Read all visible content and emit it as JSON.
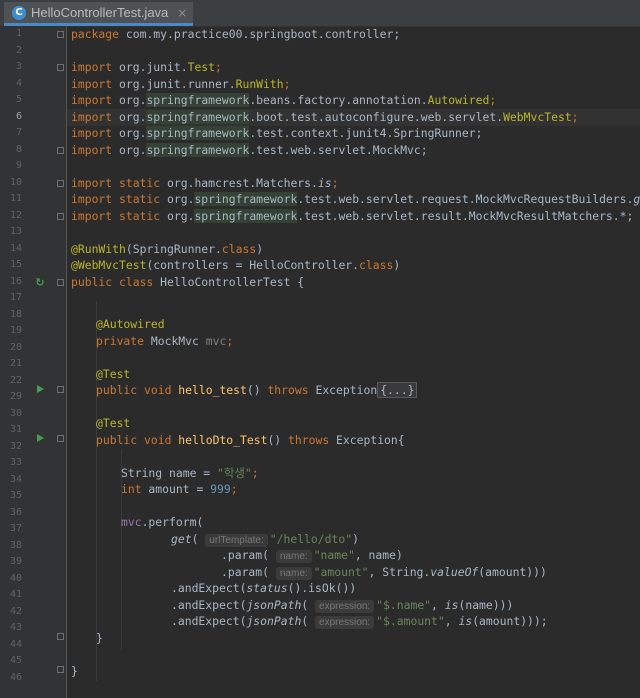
{
  "tab": {
    "icon": "java-class-icon",
    "filename": "HelloControllerTest.java",
    "close": "×"
  },
  "gutter": {
    "line_numbers": [
      "1",
      "2",
      "3",
      "4",
      "5",
      "6",
      "7",
      "8",
      "9",
      "10",
      "11",
      "12",
      "13",
      "14",
      "15",
      "16",
      "17",
      "18",
      "19",
      "20",
      "21",
      "22",
      "29",
      "30",
      "31",
      "32",
      "33",
      "34",
      "35",
      "36",
      "37",
      "38",
      "39",
      "40",
      "41",
      "42",
      "43",
      "44",
      "45",
      "46"
    ],
    "current_line": "6"
  },
  "code": {
    "l1": [
      "package",
      " com.my.practice00.springboot.controller;"
    ],
    "l3": [
      "import",
      " org.junit.",
      "Test",
      ";"
    ],
    "l4": [
      "import",
      " org.junit.runner.",
      "RunWith",
      ";"
    ],
    "l5": [
      "import",
      " org.",
      "springframework",
      ".beans.factory.annotation.",
      "Autowired",
      ";"
    ],
    "l6": [
      "import",
      " org.",
      "springframework",
      ".boot.test.autoconfigure.web.servlet.",
      "WebMvcTest",
      ";"
    ],
    "l7": [
      "import",
      " org.",
      "springframework",
      ".test.context.junit4.SpringRunner;"
    ],
    "l8": [
      "import",
      " org.",
      "springframework",
      ".test.web.servlet.MockMvc;"
    ],
    "l10": [
      "import static",
      " org.hamcrest.Matchers.",
      "is",
      ";"
    ],
    "l11": [
      "import static",
      " org.",
      "springframework",
      ".test.web.servlet.request.MockMvcRequestBuilders.",
      "get",
      ";"
    ],
    "l12": [
      "import static",
      " org.",
      "springframework",
      ".test.web.servlet.result.MockMvcResultMatchers.*;"
    ],
    "l14": [
      "@RunWith",
      "(SpringRunner.",
      "class",
      ")"
    ],
    "l15": [
      "@WebMvcTest",
      "(controllers = HelloController.",
      "class",
      ")"
    ],
    "l16": [
      "public class",
      " HelloControllerTest {"
    ],
    "l18": [
      "@Autowired"
    ],
    "l19": [
      "private",
      " MockMvc ",
      "mvc",
      ";"
    ],
    "l21": [
      "@Test"
    ],
    "l22": [
      "public void",
      " ",
      "hello_test",
      "() ",
      "throws",
      " Exception",
      "{...}"
    ],
    "l30": [
      "@Test"
    ],
    "l31": [
      "public void",
      " ",
      "helloDto_Test",
      "() ",
      "throws",
      " Exception{"
    ],
    "l33": [
      "String name = ",
      "\"학생\"",
      ";"
    ],
    "l34": [
      "int",
      " amount = ",
      "999",
      ";"
    ],
    "l36": [
      "mvc",
      ".perform("
    ],
    "l37": [
      "get",
      "( ",
      "urlTemplate:",
      "\"/hello/dto\"",
      ")"
    ],
    "l38": [
      ".param( ",
      "name:",
      "\"name\"",
      ", name)"
    ],
    "l39": [
      ".param( ",
      "name:",
      "\"amount\"",
      ", String.",
      "valueOf",
      "(amount)))"
    ],
    "l40": [
      ".andExpect(",
      "status",
      "().isOk())"
    ],
    "l41": [
      ".andExpect(",
      "jsonPath",
      "( ",
      "expression:",
      "\"$.name\"",
      ", ",
      "is",
      "(name)))"
    ],
    "l42": [
      ".andExpect(",
      "jsonPath",
      "( ",
      "expression:",
      "\"$.amount\"",
      ", ",
      "is",
      "(amount)));"
    ],
    "l43": [
      "}"
    ],
    "l45": [
      "}"
    ]
  },
  "colors": {
    "background": "#2b2b2b",
    "keyword": "#cc7832",
    "annotation": "#bbb529",
    "string": "#6a8759",
    "number": "#6897bb",
    "field": "#9876aa",
    "method": "#ffc66d",
    "run_icon": "#499c54"
  }
}
